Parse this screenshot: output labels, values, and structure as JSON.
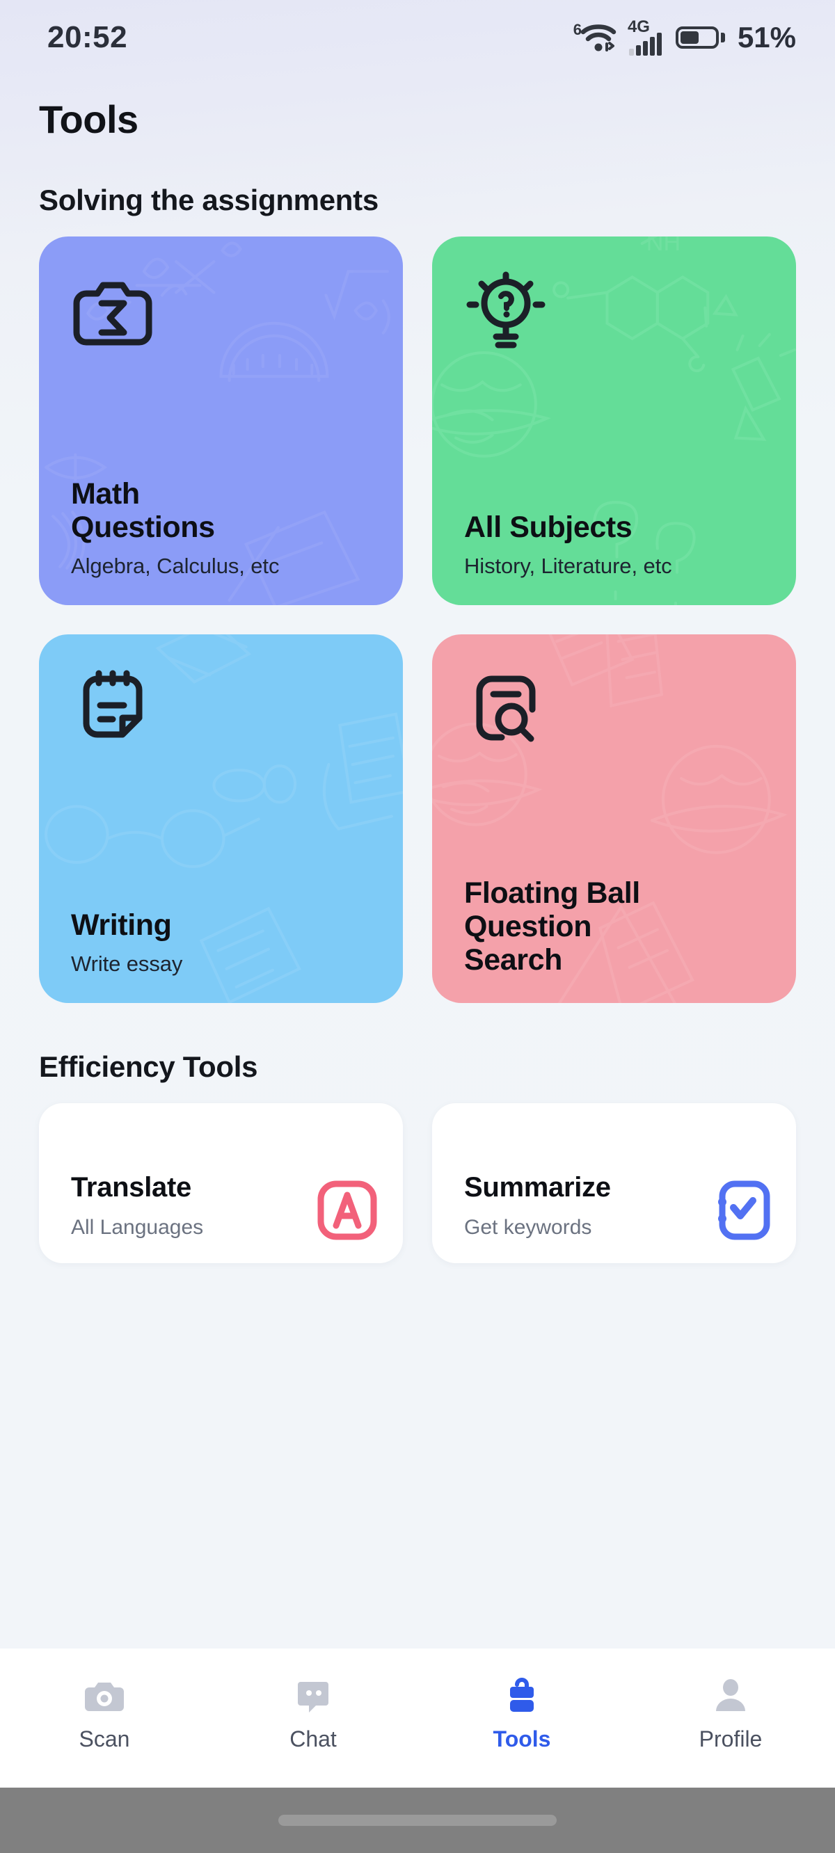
{
  "status_bar": {
    "time": "20:52",
    "wifi_generation": "6",
    "network_type": "4G",
    "battery_percent": "51%",
    "icons": [
      "wifi-icon",
      "signal-bars-icon",
      "battery-icon"
    ]
  },
  "header": {
    "title": "Tools"
  },
  "sections": [
    {
      "id": "solving",
      "title": "Solving the assignments"
    },
    {
      "id": "efficiency",
      "title": "Efficiency Tools"
    }
  ],
  "tool_cards": [
    {
      "title": "Math\nQuestions",
      "subtitle": "Algebra, Calculus, etc",
      "icon": "camera-sigma-icon",
      "bg_color": "#8b9cf7",
      "doodle_color": "#a8b5f9"
    },
    {
      "title": "All Subjects",
      "subtitle": "History, Literature, etc",
      "icon": "lightbulb-question-icon",
      "bg_color": "#64dd98",
      "doodle_color": "#8ee9b4"
    },
    {
      "title": "Writing",
      "subtitle": "Write essay",
      "icon": "notepad-icon",
      "bg_color": "#7ecbf7",
      "doodle_color": "#a4dbfa"
    },
    {
      "title": "Floating Ball\nQuestion\nSearch",
      "subtitle": "",
      "icon": "document-search-icon",
      "bg_color": "#f4a1aa",
      "doodle_color": "#f7bcc2"
    }
  ],
  "efficiency_cards": [
    {
      "title": "Translate",
      "subtitle": "All Languages",
      "icon": "letter-a-box-icon",
      "accent_color": "#f2617a"
    },
    {
      "title": "Summarize",
      "subtitle": "Get keywords",
      "icon": "notebook-check-icon",
      "accent_color": "#5271f2"
    }
  ],
  "bottom_nav": {
    "active_color": "#2f5bea",
    "inactive_color": "#c3c7d2",
    "items": [
      {
        "label": "Scan",
        "icon": "camera-icon",
        "active": false
      },
      {
        "label": "Chat",
        "icon": "chat-bubble-icon",
        "active": false
      },
      {
        "label": "Tools",
        "icon": "toolbox-icon",
        "active": true
      },
      {
        "label": "Profile",
        "icon": "person-icon",
        "active": false
      }
    ]
  }
}
